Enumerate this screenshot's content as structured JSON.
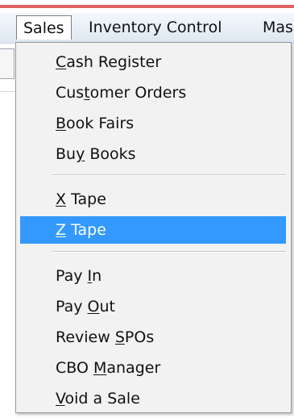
{
  "menubar": {
    "items": [
      {
        "label": "Sales",
        "active": true
      },
      {
        "label": "Inventory Control",
        "active": false
      },
      {
        "label": "Mas",
        "active": false
      }
    ]
  },
  "dropdown": {
    "items": [
      {
        "pre": "",
        "key": "C",
        "post": "ash Register",
        "highlighted": false
      },
      {
        "pre": "Cus",
        "key": "t",
        "post": "omer Orders",
        "highlighted": false
      },
      {
        "pre": "",
        "key": "B",
        "post": "ook Fairs",
        "highlighted": false
      },
      {
        "pre": "Bu",
        "key": "y",
        "post": " Books",
        "highlighted": false
      },
      {
        "pre": "",
        "key": "X",
        "post": " Tape",
        "highlighted": false
      },
      {
        "pre": "",
        "key": "Z",
        "post": " Tape",
        "highlighted": true
      },
      {
        "pre": "Pay ",
        "key": "I",
        "post": "n",
        "highlighted": false
      },
      {
        "pre": "Pay ",
        "key": "O",
        "post": "ut",
        "highlighted": false
      },
      {
        "pre": "Review ",
        "key": "S",
        "post": "POs",
        "highlighted": false
      },
      {
        "pre": "CBO ",
        "key": "M",
        "post": "anager",
        "highlighted": false
      },
      {
        "pre": "",
        "key": "V",
        "post": "oid a Sale",
        "highlighted": false
      }
    ]
  },
  "colors": {
    "highlight": "#3399ff",
    "title_accent": "#e0625d",
    "menu_background": "#f2f2f2"
  }
}
